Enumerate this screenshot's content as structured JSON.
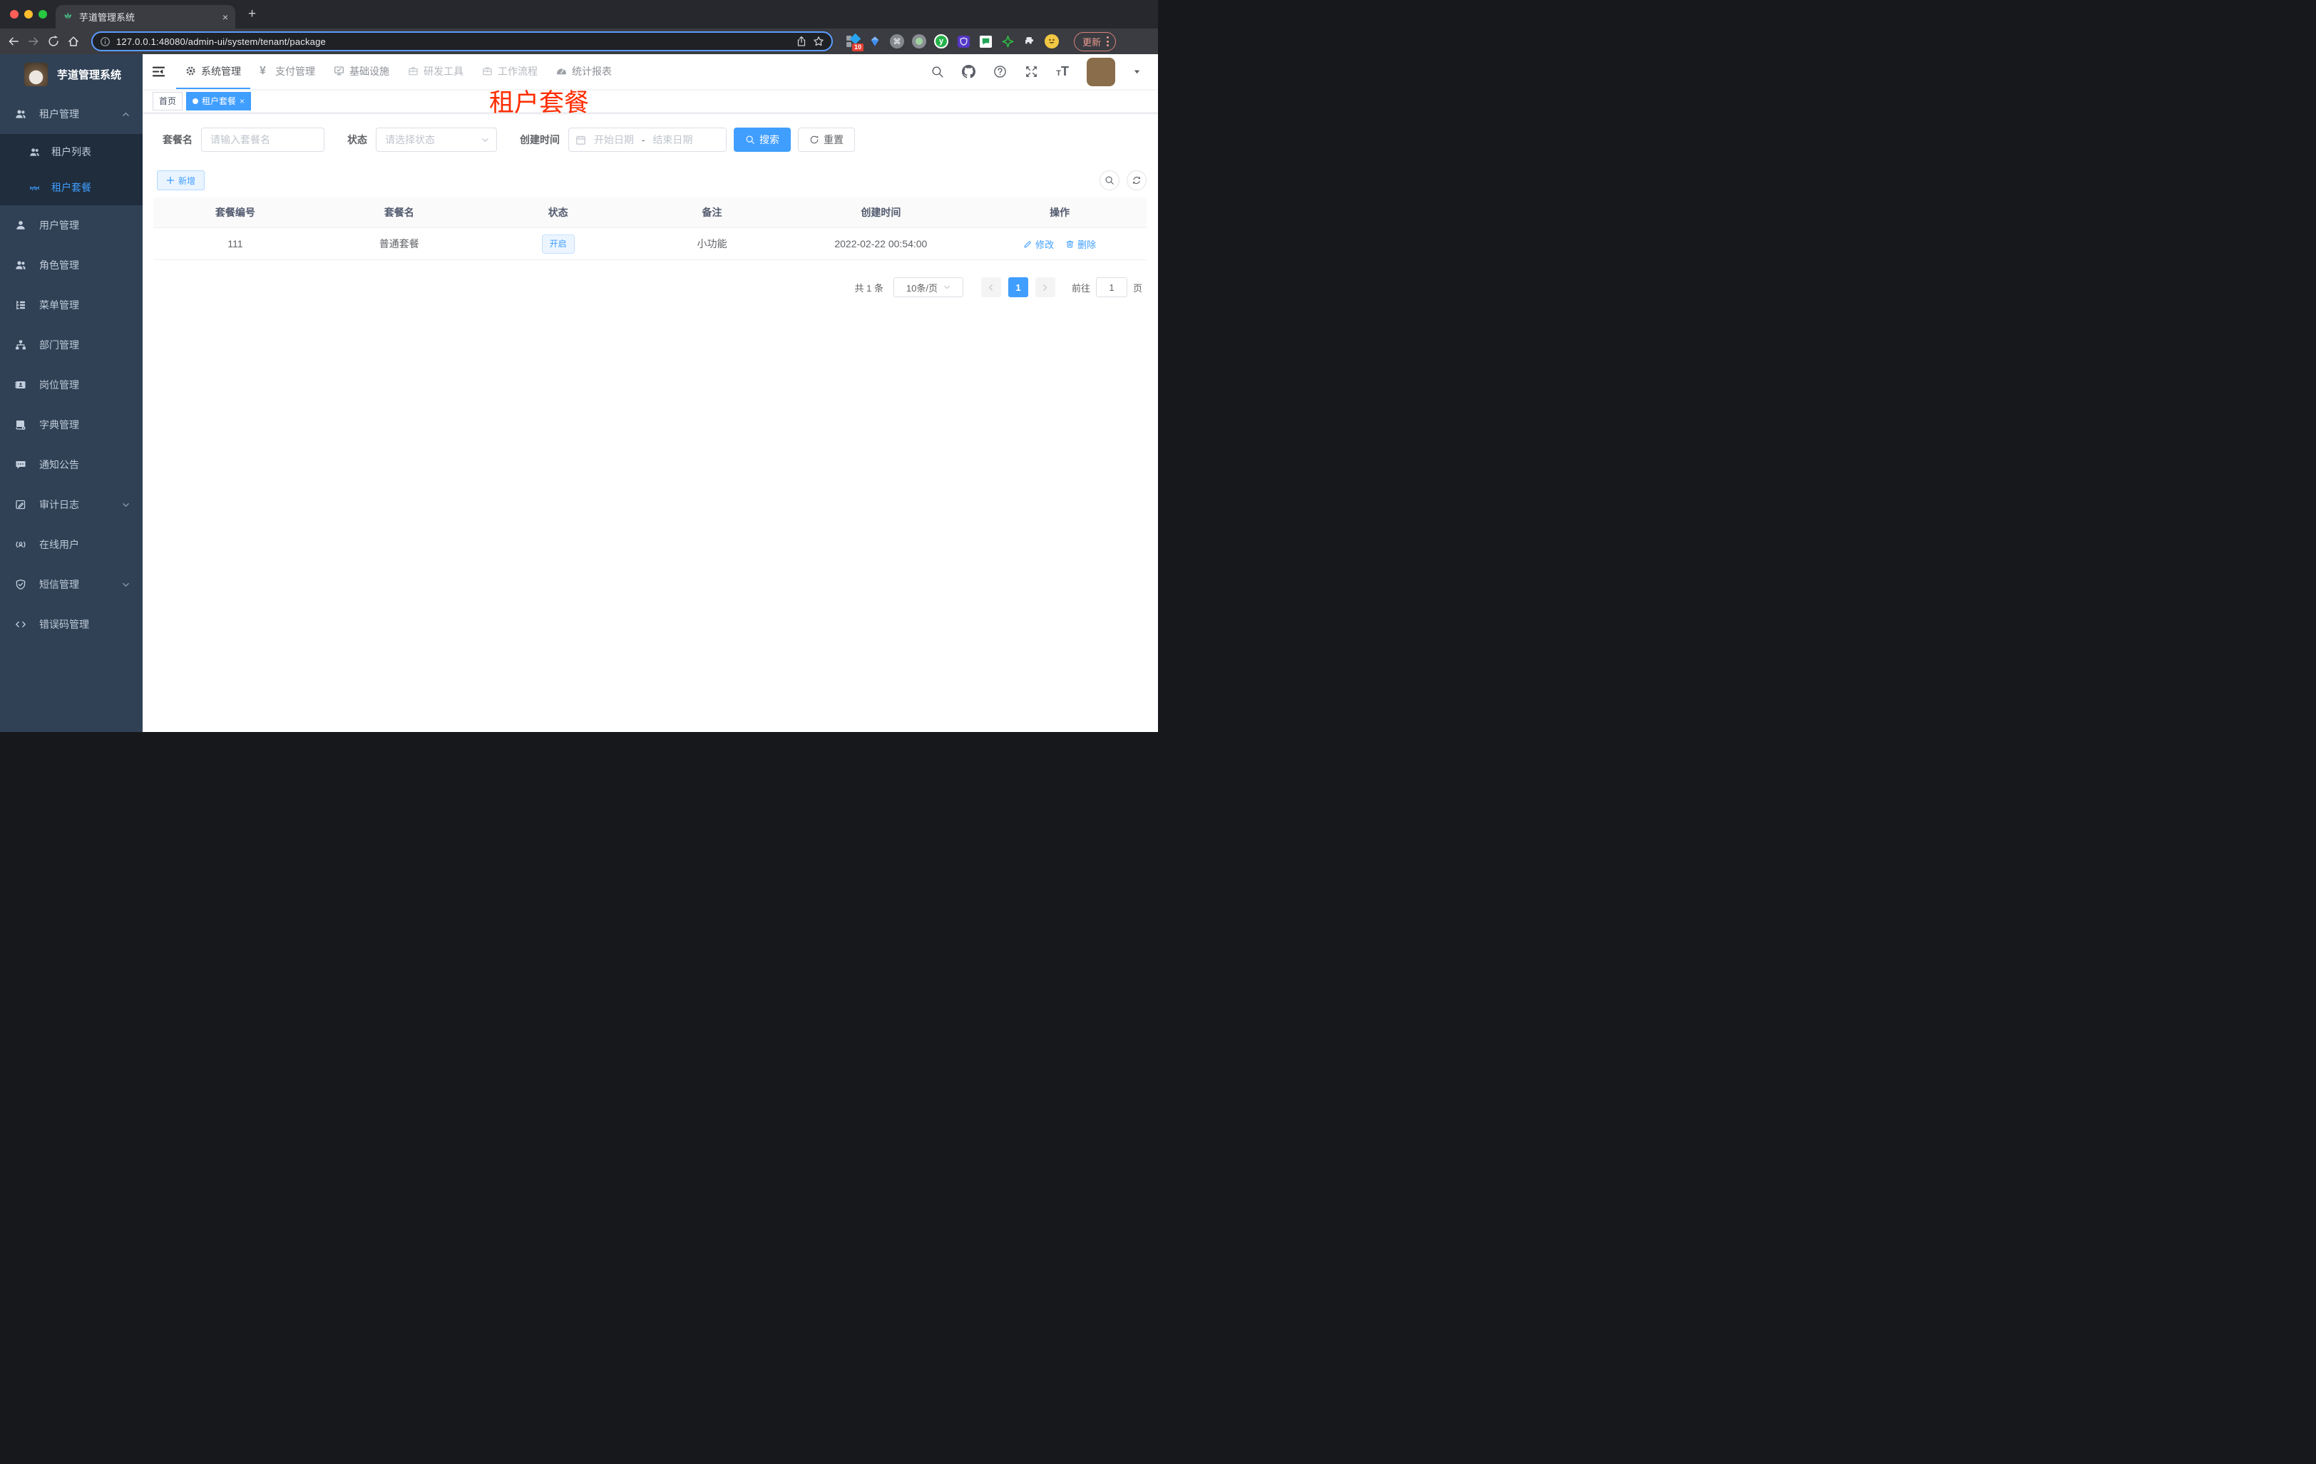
{
  "browser": {
    "tab_title": "芋道管理系统",
    "close_glyph": "×",
    "new_tab_glyph": "+",
    "url": "127.0.0.1:48080/admin-ui/system/tenant/package",
    "ext_badge": "10",
    "ext_cmd": "⌘",
    "ext_y": "y",
    "update_label": "更新"
  },
  "sidebar": {
    "title": "芋道管理系统",
    "items": [
      {
        "label": "租户管理"
      },
      {
        "label": "租户列表"
      },
      {
        "label": "租户套餐"
      },
      {
        "label": "用户管理"
      },
      {
        "label": "角色管理"
      },
      {
        "label": "菜单管理"
      },
      {
        "label": "部门管理"
      },
      {
        "label": "岗位管理"
      },
      {
        "label": "字典管理"
      },
      {
        "label": "通知公告"
      },
      {
        "label": "审计日志"
      },
      {
        "label": "在线用户"
      },
      {
        "label": "短信管理"
      },
      {
        "label": "错误码管理"
      }
    ]
  },
  "topnav": {
    "yen_glyph": "¥",
    "items": [
      {
        "label": "系统管理"
      },
      {
        "label": "支付管理"
      },
      {
        "label": "基础设施"
      },
      {
        "label": "研发工具"
      },
      {
        "label": "工作流程"
      },
      {
        "label": "统计报表"
      }
    ]
  },
  "nav_right": {
    "help_glyph": "?",
    "font_small": "T",
    "font_big": "T"
  },
  "tags": {
    "home": "首页",
    "active": "租户套餐",
    "close_glyph": "×"
  },
  "annotation": {
    "text": "租户套餐"
  },
  "filters": {
    "name_label": "套餐名",
    "name_placeholder": "请输入套餐名",
    "status_label": "状态",
    "status_placeholder": "请选择状态",
    "date_label": "创建时间",
    "date_start_placeholder": "开始日期",
    "date_separator": "-",
    "date_end_placeholder": "结束日期",
    "search_label": "搜索",
    "reset_label": "重置"
  },
  "toolbar": {
    "add_label": "新增"
  },
  "table": {
    "headers": [
      "套餐编号",
      "套餐名",
      "状态",
      "备注",
      "创建时间",
      "操作"
    ],
    "rows": [
      {
        "id": "111",
        "name": "普通套餐",
        "status": "开启",
        "remark": "小功能",
        "created": "2022-02-22 00:54:00",
        "edit": "修改",
        "delete": "删除"
      }
    ]
  },
  "pagination": {
    "total": "共 1 条",
    "page_size": "10条/页",
    "current_page": "1",
    "goto_label": "前往",
    "goto_value": "1",
    "page_unit": "页"
  },
  "colors": {
    "accent": "#409eff",
    "annotation_red": "#ff2d00"
  }
}
